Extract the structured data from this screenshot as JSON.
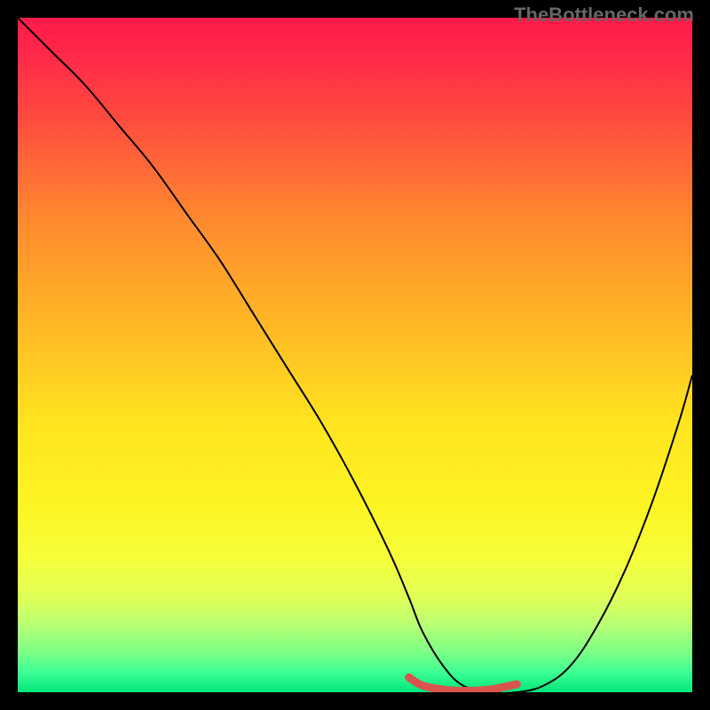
{
  "watermark": "TheBottleneck.com",
  "gradient": {
    "stops": [
      {
        "offset": 0.0,
        "color": "#ff1a4a"
      },
      {
        "offset": 0.05,
        "color": "#ff2749"
      },
      {
        "offset": 0.15,
        "color": "#ff4b3e"
      },
      {
        "offset": 0.3,
        "color": "#ff8a2f"
      },
      {
        "offset": 0.45,
        "color": "#ffb726"
      },
      {
        "offset": 0.6,
        "color": "#ffe41f"
      },
      {
        "offset": 0.72,
        "color": "#fdf423"
      },
      {
        "offset": 0.8,
        "color": "#f6ff3a"
      },
      {
        "offset": 0.86,
        "color": "#e0ff58"
      },
      {
        "offset": 0.9,
        "color": "#b8ff73"
      },
      {
        "offset": 0.94,
        "color": "#7cff86"
      },
      {
        "offset": 0.97,
        "color": "#3eff94"
      },
      {
        "offset": 1.0,
        "color": "#00e67a"
      }
    ]
  },
  "chart_data": {
    "type": "line",
    "title": "",
    "xlabel": "",
    "ylabel": "",
    "xlim": [
      0,
      100
    ],
    "ylim": [
      0,
      100
    ],
    "series": [
      {
        "name": "bottleneck-curve",
        "color": "#000000",
        "width": 2,
        "x": [
          0,
          5,
          10,
          15,
          20,
          25,
          30,
          35,
          40,
          45,
          50,
          55,
          58,
          60,
          63,
          66,
          70,
          74,
          78,
          82,
          86,
          90,
          94,
          98,
          100
        ],
        "y": [
          100,
          95,
          90,
          84,
          78,
          71,
          64,
          56,
          48,
          40,
          31,
          21,
          14,
          9,
          4,
          1,
          0,
          0,
          1,
          4,
          10,
          18,
          28,
          40,
          47
        ]
      },
      {
        "name": "sweet-spot-marker",
        "color": "#d9544d",
        "width": 9,
        "linecap": "round",
        "x": [
          58,
          60,
          63,
          66,
          70,
          74
        ],
        "y": [
          2.2,
          1.0,
          0.4,
          0.2,
          0.4,
          1.2
        ]
      }
    ]
  }
}
